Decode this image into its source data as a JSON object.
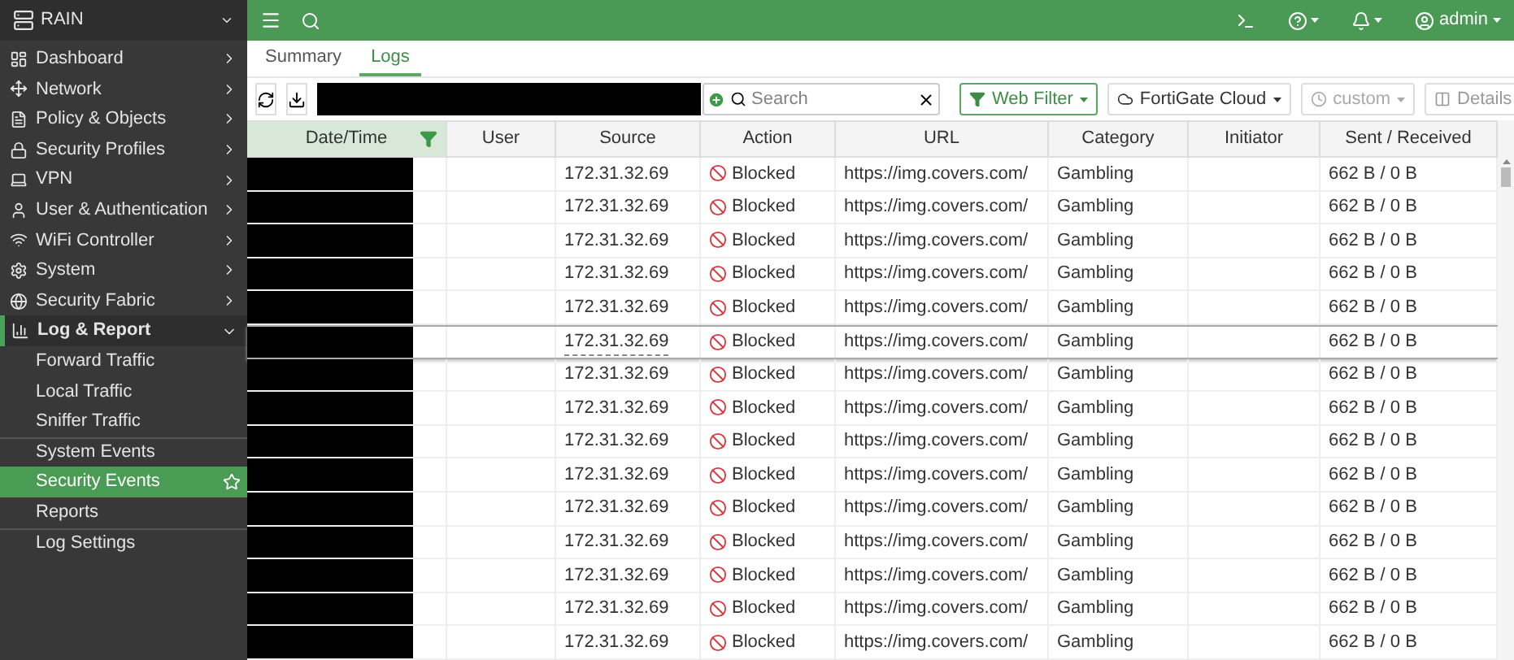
{
  "device": {
    "name": "RAIN"
  },
  "sidebar": {
    "items": [
      {
        "label": "Dashboard",
        "expanded": false
      },
      {
        "label": "Network",
        "expanded": false
      },
      {
        "label": "Policy & Objects",
        "expanded": false
      },
      {
        "label": "Security Profiles",
        "expanded": false
      },
      {
        "label": "VPN",
        "expanded": false
      },
      {
        "label": "User & Authentication",
        "expanded": false
      },
      {
        "label": "WiFi Controller",
        "expanded": false
      },
      {
        "label": "System",
        "expanded": false
      },
      {
        "label": "Security Fabric",
        "expanded": false
      },
      {
        "label": "Log & Report",
        "expanded": true,
        "children": [
          {
            "label": "Forward Traffic",
            "selected": false,
            "divider_before": false
          },
          {
            "label": "Local Traffic",
            "selected": false,
            "divider_before": false
          },
          {
            "label": "Sniffer Traffic",
            "selected": false,
            "divider_before": false
          },
          {
            "label": "System Events",
            "selected": false,
            "divider_before": true
          },
          {
            "label": "Security Events",
            "selected": true,
            "divider_before": false
          },
          {
            "label": "Reports",
            "selected": false,
            "divider_before": false
          },
          {
            "label": "Log Settings",
            "selected": false,
            "divider_before": true
          }
        ]
      }
    ]
  },
  "topbar": {
    "user": "admin"
  },
  "tabs": [
    {
      "label": "Summary",
      "selected": false
    },
    {
      "label": "Logs",
      "selected": true
    }
  ],
  "toolbar": {
    "search_placeholder": "Search",
    "filters": [
      {
        "label": "Web Filter",
        "kind": "active"
      },
      {
        "label": "FortiGate Cloud",
        "kind": "source"
      },
      {
        "label": "custom",
        "kind": "time"
      },
      {
        "label": "Details",
        "kind": "details"
      }
    ]
  },
  "table": {
    "columns": [
      "Date/Time",
      "User",
      "Source",
      "Action",
      "URL",
      "Category",
      "Initiator",
      "Sent / Received"
    ],
    "rows": [
      {
        "source": "172.31.32.69",
        "action": "Blocked",
        "url": "https://img.covers.com/",
        "category": "Gambling",
        "sent_received": "662 B / 0 B",
        "selected": false
      },
      {
        "source": "172.31.32.69",
        "action": "Blocked",
        "url": "https://img.covers.com/",
        "category": "Gambling",
        "sent_received": "662 B / 0 B",
        "selected": false
      },
      {
        "source": "172.31.32.69",
        "action": "Blocked",
        "url": "https://img.covers.com/",
        "category": "Gambling",
        "sent_received": "662 B / 0 B",
        "selected": false
      },
      {
        "source": "172.31.32.69",
        "action": "Blocked",
        "url": "https://img.covers.com/",
        "category": "Gambling",
        "sent_received": "662 B / 0 B",
        "selected": false
      },
      {
        "source": "172.31.32.69",
        "action": "Blocked",
        "url": "https://img.covers.com/",
        "category": "Gambling",
        "sent_received": "662 B / 0 B",
        "selected": false
      },
      {
        "source": "172.31.32.69",
        "action": "Blocked",
        "url": "https://img.covers.com/",
        "category": "Gambling",
        "sent_received": "662 B / 0 B",
        "selected": true
      },
      {
        "source": "172.31.32.69",
        "action": "Blocked",
        "url": "https://img.covers.com/",
        "category": "Gambling",
        "sent_received": "662 B / 0 B",
        "selected": false
      },
      {
        "source": "172.31.32.69",
        "action": "Blocked",
        "url": "https://img.covers.com/",
        "category": "Gambling",
        "sent_received": "662 B / 0 B",
        "selected": false
      },
      {
        "source": "172.31.32.69",
        "action": "Blocked",
        "url": "https://img.covers.com/",
        "category": "Gambling",
        "sent_received": "662 B / 0 B",
        "selected": false
      },
      {
        "source": "172.31.32.69",
        "action": "Blocked",
        "url": "https://img.covers.com/",
        "category": "Gambling",
        "sent_received": "662 B / 0 B",
        "selected": false
      },
      {
        "source": "172.31.32.69",
        "action": "Blocked",
        "url": "https://img.covers.com/",
        "category": "Gambling",
        "sent_received": "662 B / 0 B",
        "selected": false
      },
      {
        "source": "172.31.32.69",
        "action": "Blocked",
        "url": "https://img.covers.com/",
        "category": "Gambling",
        "sent_received": "662 B / 0 B",
        "selected": false
      },
      {
        "source": "172.31.32.69",
        "action": "Blocked",
        "url": "https://img.covers.com/",
        "category": "Gambling",
        "sent_received": "662 B / 0 B",
        "selected": false
      },
      {
        "source": "172.31.32.69",
        "action": "Blocked",
        "url": "https://img.covers.com/",
        "category": "Gambling",
        "sent_received": "662 B / 0 B",
        "selected": false
      },
      {
        "source": "172.31.32.69",
        "action": "Blocked",
        "url": "https://img.covers.com/",
        "category": "Gambling",
        "sent_received": "662 B / 0 B",
        "selected": false
      }
    ]
  }
}
